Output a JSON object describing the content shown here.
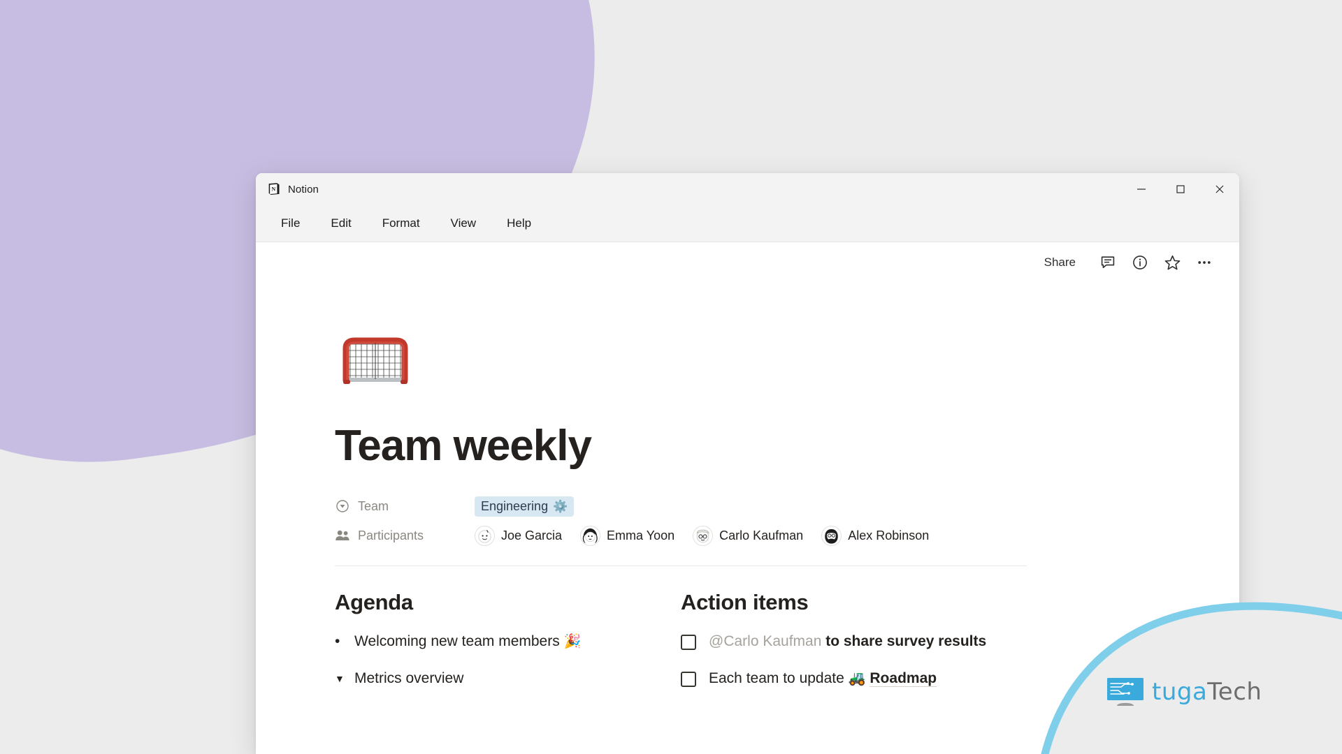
{
  "window": {
    "app_title": "Notion",
    "app_icon": "notion-logo-icon",
    "controls": {
      "minimize": "minimize-icon",
      "maximize": "maximize-icon",
      "close": "close-icon"
    }
  },
  "menubar": {
    "items": [
      {
        "label": "File"
      },
      {
        "label": "Edit"
      },
      {
        "label": "Format"
      },
      {
        "label": "View"
      },
      {
        "label": "Help"
      }
    ]
  },
  "toolbar": {
    "share_label": "Share",
    "icons": [
      {
        "name": "comment-icon"
      },
      {
        "name": "info-icon"
      },
      {
        "name": "star-icon"
      },
      {
        "name": "more-options-icon"
      }
    ]
  },
  "page": {
    "icon_emoji": "🥅",
    "icon_name": "hockey-goal-emoji",
    "title": "Team weekly",
    "properties": [
      {
        "label": "Team",
        "icon": "select-property-icon",
        "type": "select",
        "value": "Engineering",
        "value_emoji": "⚙️",
        "tag_bg": "#d7e8f2",
        "tag_color": "#2c3d4f"
      },
      {
        "label": "Participants",
        "icon": "people-property-icon",
        "type": "person",
        "people": [
          {
            "name": "Joe Garcia",
            "avatar_emoji": "👶"
          },
          {
            "name": "Emma Yoon",
            "avatar_emoji": "👩"
          },
          {
            "name": "Carlo Kaufman",
            "avatar_emoji": "👨‍🦳"
          },
          {
            "name": "Alex Robinson",
            "avatar_emoji": "🧔"
          }
        ]
      }
    ],
    "columns": [
      {
        "heading": "Agenda",
        "blocks": [
          {
            "type": "bulleted",
            "marker": "•",
            "text": "Welcoming new team members",
            "emoji": "🎉"
          },
          {
            "type": "toggle",
            "marker": "▼",
            "text": "Metrics overview",
            "emoji": ""
          }
        ]
      },
      {
        "heading": "Action items",
        "blocks": [
          {
            "type": "todo",
            "checked": false,
            "mention": "@Carlo Kaufman",
            "text": " to share survey results",
            "emoji": ""
          },
          {
            "type": "todo",
            "checked": false,
            "text": "Each team to update ",
            "emoji": "🚜",
            "link": "Roadmap"
          }
        ]
      }
    ]
  },
  "watermark": {
    "brand_first": "tuga",
    "brand_second": "Tech",
    "color_primary": "#3aa9db",
    "color_secondary": "#6d6d6d"
  },
  "background": {
    "base_color": "#ececec",
    "blob_color": "#c7bde2",
    "arc_color": "#7fcfeb"
  }
}
